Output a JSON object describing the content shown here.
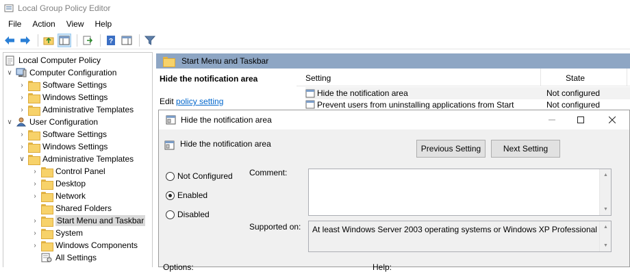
{
  "window": {
    "title": "Local Group Policy Editor"
  },
  "menu": [
    "File",
    "Action",
    "View",
    "Help"
  ],
  "toolbar": {
    "icons": [
      "back-arrow-icon",
      "forward-arrow-icon",
      "up-folder-icon",
      "show-hide-tree-icon",
      "export-list-icon",
      "help-icon",
      "show-hide-action-pane-icon",
      "filter-icon"
    ]
  },
  "tree": {
    "root": "Local Computer Policy",
    "computer": {
      "label": "Computer Configuration",
      "children": [
        "Software Settings",
        "Windows Settings",
        "Administrative Templates"
      ]
    },
    "user": {
      "label": "User Configuration",
      "children": [
        "Software Settings",
        "Windows Settings",
        "Administrative Templates"
      ],
      "admin_children": [
        "Control Panel",
        "Desktop",
        "Network",
        "Shared Folders",
        "Start Menu and Taskbar",
        "System",
        "Windows Components",
        "All Settings"
      ],
      "selected": "Start Menu and Taskbar"
    }
  },
  "right": {
    "header": "Start Menu and Taskbar",
    "ext_title": "Hide the notification area",
    "edit_prefix": "Edit",
    "edit_link": "policy setting",
    "columns": {
      "setting": "Setting",
      "state": "State"
    },
    "rows": [
      {
        "setting": "Hide the notification area",
        "state": "Not configured"
      },
      {
        "setting": "Prevent users from uninstalling applications from Start",
        "state": "Not configured"
      }
    ]
  },
  "dialog": {
    "title": "Hide the notification area",
    "policy_name": "Hide the notification area",
    "prev_button": "Previous Setting",
    "next_button": "Next Setting",
    "options": [
      {
        "label": "Not Configured",
        "checked": false
      },
      {
        "label": "Enabled",
        "checked": true
      },
      {
        "label": "Disabled",
        "checked": false
      }
    ],
    "comment_label": "Comment:",
    "comment_value": "",
    "supported_label": "Supported on:",
    "supported_value": "At least Windows Server 2003 operating systems or Windows XP Professional",
    "options_label": "Options:",
    "help_label": "Help:"
  },
  "colors": {
    "header_bg": "#8ea6c4",
    "link": "#0066cc",
    "dialog_bg": "#f0f0f0"
  }
}
